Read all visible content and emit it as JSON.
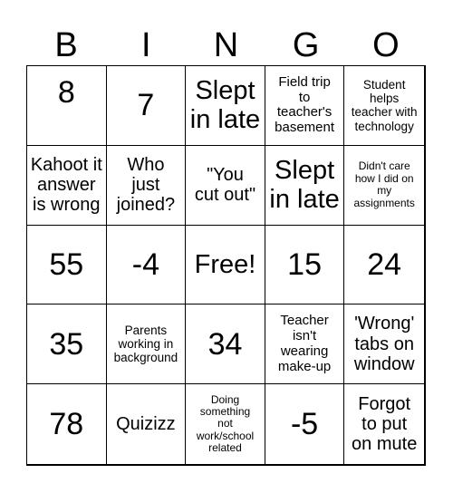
{
  "header": {
    "letters": [
      "B",
      "I",
      "N",
      "G",
      "O"
    ]
  },
  "board": {
    "cells": [
      "8",
      "7",
      "Slept\nin late",
      "Field trip\nto\nteacher's\nbasement",
      "Student\nhelps\nteacher with\ntechnology",
      "Kahoot it\nanswer\nis wrong",
      "Who\njust\njoined?",
      "\"You\ncut out\"",
      "Slept\nin late",
      "Didn't care\nhow I did on\nmy\nassignments",
      "55",
      "-4",
      "Free!",
      "15",
      "24",
      "35",
      "Parents\nworking in\nbackground",
      "34",
      "Teacher\nisn't\nwearing\nmake-up",
      "'Wrong'\ntabs on\nwindow",
      "78",
      "Quizizz",
      "Doing\nsomething\nnot\nwork/school\nrelated",
      "-5",
      "Forgot\nto put\non mute"
    ]
  }
}
